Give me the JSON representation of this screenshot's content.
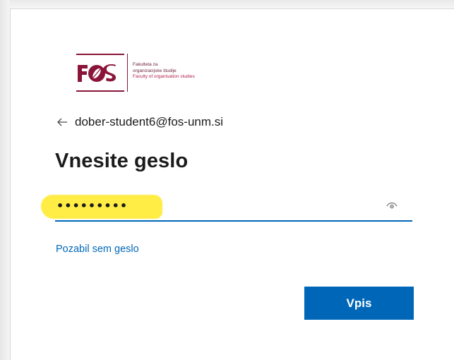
{
  "logo": {
    "mark": "FOS",
    "line1": "Fakulteta za",
    "line2": "organizacijske študije",
    "line3": "Faculty of organisation studies",
    "brand_color": "#8a1538"
  },
  "identity": {
    "back_icon": "arrow-left-icon",
    "email": "dober-student6@fos-unm.si"
  },
  "title": "Vnesite geslo",
  "password": {
    "masked_value": "•••••••••",
    "reveal_icon": "eye-icon",
    "highlight_color": "#ffeb3b",
    "underline_color": "#0067b8"
  },
  "forgot_link": "Pozabil sem geslo",
  "signin_button": "Vpis",
  "accent_color": "#0067b8"
}
